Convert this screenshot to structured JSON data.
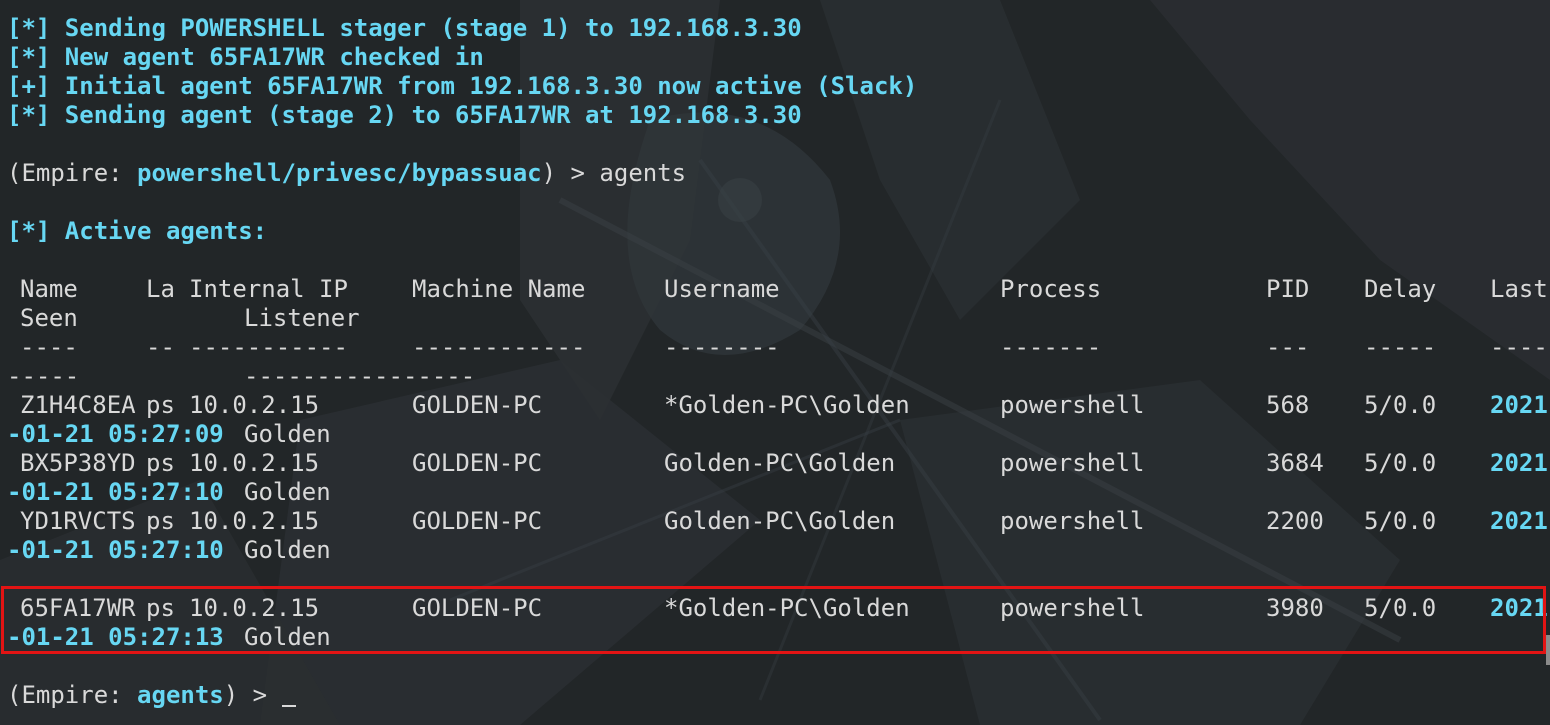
{
  "log": [
    "[*] Sending POWERSHELL stager (stage 1) to 192.168.3.30",
    "[*] New agent 65FA17WR checked in",
    "[+] Initial agent 65FA17WR from 192.168.3.30 now active (Slack)",
    "[*] Sending agent (stage 2) to 65FA17WR at 192.168.3.30"
  ],
  "prompt1": {
    "prefix": "(Empire: ",
    "module": "powershell/privesc/bypassuac",
    "suffix": ") > ",
    "command": "agents"
  },
  "active_header": "[*] Active agents:",
  "table": {
    "headers": {
      "name": "Name",
      "la": "La",
      "internal_ip": "Internal IP",
      "machine": "Machine Name",
      "username": "Username",
      "process": "Process",
      "pid": "PID",
      "delay": "Delay",
      "last": "Last",
      "seen": "Seen",
      "listener": "Listener"
    },
    "dashes1": {
      "name": "----",
      "la": "--",
      "internal_ip": "-----------",
      "machine": "------------",
      "username": "--------",
      "process": "-------",
      "pid": "---",
      "delay": "-----",
      "last": "----"
    },
    "dashes2": {
      "seen": "-----",
      "listener": "----------------"
    },
    "rows": [
      {
        "name": "Z1H4C8EA",
        "la": "ps",
        "ip": "10.0.2.15",
        "machine": "GOLDEN-PC",
        "username": "*Golden-PC\\Golden",
        "process": "powershell",
        "pid": "568",
        "delay": "5/0.0",
        "year": "2021",
        "datetime": "-01-21 05:27:09",
        "listener": "Golden"
      },
      {
        "name": "BX5P38YD",
        "la": "ps",
        "ip": "10.0.2.15",
        "machine": "GOLDEN-PC",
        "username": "Golden-PC\\Golden",
        "process": "powershell",
        "pid": "3684",
        "delay": "5/0.0",
        "year": "2021",
        "datetime": "-01-21 05:27:10",
        "listener": "Golden"
      },
      {
        "name": "YD1RVCTS",
        "la": "ps",
        "ip": "10.0.2.15",
        "machine": "GOLDEN-PC",
        "username": "Golden-PC\\Golden",
        "process": "powershell",
        "pid": "2200",
        "delay": "5/0.0",
        "year": "2021",
        "datetime": "-01-21 05:27:10",
        "listener": "Golden"
      },
      {
        "name": "65FA17WR",
        "la": "ps",
        "ip": "10.0.2.15",
        "machine": "GOLDEN-PC",
        "username": "*Golden-PC\\Golden",
        "process": "powershell",
        "pid": "3980",
        "delay": "5/0.0",
        "year": "2021",
        "datetime": "-01-21 05:27:13",
        "listener": "Golden"
      }
    ]
  },
  "prompt2": {
    "prefix": "(Empire: ",
    "module": "agents",
    "suffix": ") > "
  },
  "colors": {
    "background": "#222628",
    "text": "#d9d9d9",
    "accent_cyan": "#67d7f3",
    "highlight_red": "#e31414"
  }
}
